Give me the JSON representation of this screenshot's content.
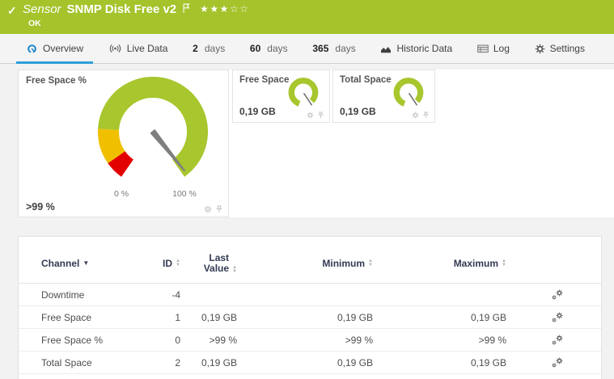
{
  "header": {
    "kind": "Sensor",
    "title": "SNMP Disk Free v2",
    "status": "OK",
    "rating_filled": "★★★",
    "rating_empty": "☆☆"
  },
  "tabs": [
    {
      "label": "Overview",
      "active": true
    },
    {
      "label": "Live Data"
    },
    {
      "num": "2",
      "word": "days"
    },
    {
      "num": "60",
      "word": "days"
    },
    {
      "num": "365",
      "word": "days"
    },
    {
      "label": "Historic Data"
    },
    {
      "label": "Log"
    },
    {
      "label": "Settings"
    }
  ],
  "gauges": {
    "main": {
      "title": "Free Space %",
      "value": ">99 %",
      "scale_min": "0 %",
      "scale_max": "100 %"
    },
    "minis": [
      {
        "title": "Free Space",
        "value": "0,19 GB"
      },
      {
        "title": "Total Space",
        "value": "0,19 GB"
      }
    ]
  },
  "table": {
    "headers": {
      "channel": "Channel",
      "id": "ID",
      "last_line1": "Last",
      "last_line2": "Value",
      "min": "Minimum",
      "max": "Maximum"
    },
    "rows": [
      {
        "channel": "Downtime",
        "id": "-4",
        "last": "",
        "min": "",
        "max": ""
      },
      {
        "channel": "Free Space",
        "id": "1",
        "last": "0,19 GB",
        "min": "0,19 GB",
        "max": "0,19 GB"
      },
      {
        "channel": "Free Space %",
        "id": "0",
        "last": ">99 %",
        "min": ">99 %",
        "max": ">99 %"
      },
      {
        "channel": "Total Space",
        "id": "2",
        "last": "0,19 GB",
        "min": "0,19 GB",
        "max": "0,19 GB"
      }
    ]
  },
  "colors": {
    "header_green": "#a5c32b",
    "gauge_green": "#a8c62d",
    "gauge_yellow": "#f0c000",
    "gauge_red": "#e30000",
    "accent_blue": "#2d9fd8",
    "needle_gray": "#7f7f7f"
  }
}
